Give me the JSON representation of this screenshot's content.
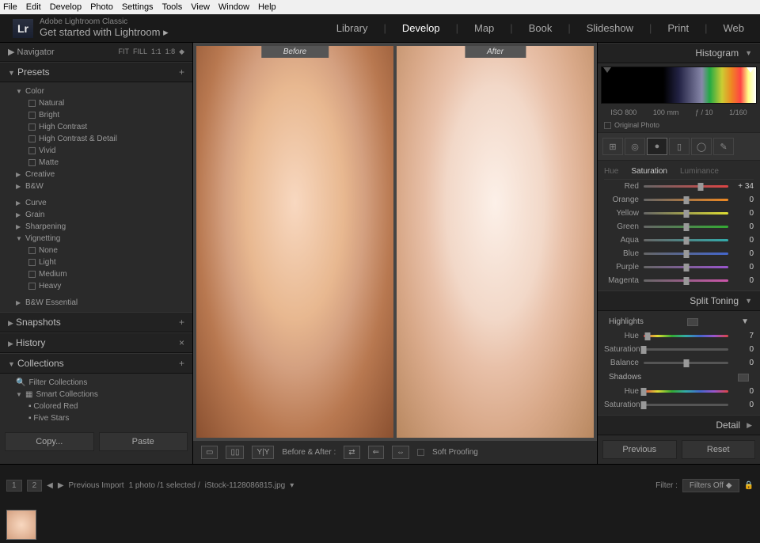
{
  "menu": [
    "File",
    "Edit",
    "Develop",
    "Photo",
    "Settings",
    "Tools",
    "View",
    "Window",
    "Help"
  ],
  "app": {
    "badge": "Lr",
    "name": "Adobe Lightroom Classic",
    "sub": "Get started with Lightroom ▸"
  },
  "modules": [
    "Library",
    "Develop",
    "Map",
    "Book",
    "Slideshow",
    "Print",
    "Web"
  ],
  "modules_active": "Develop",
  "navigator": {
    "title": "Navigator",
    "sizes": [
      "FIT",
      "FILL",
      "1:1",
      "1:8"
    ]
  },
  "presets": {
    "title": "Presets",
    "color": {
      "name": "Color",
      "items": [
        "Natural",
        "Bright",
        "High Contrast",
        "High Contrast & Detail",
        "Vivid",
        "Matte"
      ]
    },
    "groups": [
      "Creative",
      "B&W",
      "",
      "Curve",
      "Grain",
      "Sharpening"
    ],
    "vignetting": {
      "name": "Vignetting",
      "items": [
        "None",
        "Light",
        "Medium",
        "Heavy"
      ]
    },
    "last": "B&W Essential"
  },
  "snapshots": {
    "title": "Snapshots"
  },
  "history": {
    "title": "History"
  },
  "collections": {
    "title": "Collections",
    "filter": "Filter Collections",
    "smart": "Smart Collections",
    "items": [
      "Colored Red",
      "Five Stars"
    ]
  },
  "copypaste": {
    "copy": "Copy...",
    "paste": "Paste"
  },
  "view": {
    "before": "Before",
    "after": "After",
    "label": "Before & After :",
    "soft": "Soft Proofing"
  },
  "histogram": {
    "title": "Histogram",
    "iso": "ISO 800",
    "focal": "100 mm",
    "aperture": "ƒ / 10",
    "shutter": "1/160",
    "orig": "Original Photo"
  },
  "sat_tabs": [
    "Hue",
    "Saturation",
    "Luminance"
  ],
  "sat_active": "Saturation",
  "sat": [
    {
      "name": "Red",
      "val": "+ 34",
      "pos": 67,
      "cls": "grad-red"
    },
    {
      "name": "Orange",
      "val": "0",
      "pos": 50,
      "cls": "grad-orange"
    },
    {
      "name": "Yellow",
      "val": "0",
      "pos": 50,
      "cls": "grad-yellow"
    },
    {
      "name": "Green",
      "val": "0",
      "pos": 50,
      "cls": "grad-green"
    },
    {
      "name": "Aqua",
      "val": "0",
      "pos": 50,
      "cls": "grad-aqua"
    },
    {
      "name": "Blue",
      "val": "0",
      "pos": 50,
      "cls": "grad-blue"
    },
    {
      "name": "Purple",
      "val": "0",
      "pos": 50,
      "cls": "grad-purple"
    },
    {
      "name": "Magenta",
      "val": "0",
      "pos": 50,
      "cls": "grad-magenta"
    }
  ],
  "split": {
    "title": "Split Toning",
    "highlights": "Highlights",
    "shadows": "Shadows",
    "h_hue": {
      "label": "Hue",
      "val": "7",
      "pos": 5
    },
    "h_sat": {
      "label": "Saturation",
      "val": "0",
      "pos": 0
    },
    "balance": {
      "label": "Balance",
      "val": "0",
      "pos": 50
    },
    "s_hue": {
      "label": "Hue",
      "val": "0",
      "pos": 0
    },
    "s_sat": {
      "label": "Saturation",
      "val": "0",
      "pos": 0
    }
  },
  "detail": {
    "title": "Detail"
  },
  "prevreset": {
    "prev": "Previous",
    "reset": "Reset"
  },
  "film": {
    "page1": "1",
    "page2": "2",
    "prev": "Previous Import",
    "count": "1 photo /1 selected /",
    "file": "iStock-1128086815.jpg",
    "filter": "Filter :",
    "filters_off": "Filters Off"
  }
}
